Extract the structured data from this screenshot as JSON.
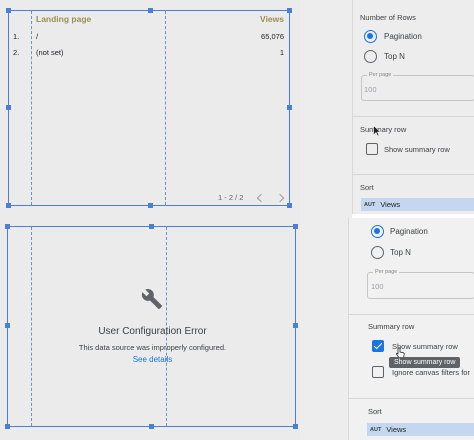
{
  "table": {
    "columns": [
      "Landing page",
      "Views"
    ],
    "rows": [
      {
        "index": "1.",
        "page": "/",
        "views": "65,076"
      },
      {
        "index": "2.",
        "page": "(not set)",
        "views": "1"
      }
    ],
    "pagination": "1 - 2 / 2"
  },
  "error": {
    "title": "User Configuration Error",
    "message": "This data source was improperly configured.",
    "link": "See details"
  },
  "props_top": {
    "number_of_rows_label": "Number of Rows",
    "pagination_label": "Pagination",
    "topn_label": "Top N",
    "per_page_label": "Per page",
    "per_page_value": "100",
    "summary_row_label": "Summary row",
    "show_summary_label": "Show summary row",
    "sort_label": "Sort",
    "sort_type": "AUT",
    "sort_field": "Views"
  },
  "props_bottom": {
    "pagination_label": "Pagination",
    "topn_label": "Top N",
    "per_page_label": "Per page",
    "per_page_value": "100",
    "summary_row_label": "Summary row",
    "show_summary_label": "Show summary row",
    "tooltip_text": "Show summary row",
    "ignore_filters_label": "Ignore canvas filters for",
    "sort_label": "Sort",
    "sort_type": "AUT",
    "sort_field": "Views"
  },
  "state": {
    "top_pagination_selected": true,
    "top_show_summary_checked": false,
    "bottom_pagination_selected": true,
    "bottom_show_summary_checked": true,
    "bottom_ignore_filters_checked": false
  },
  "colors": {
    "accent": "#1a73e8",
    "selection": "#4a7fd6",
    "header_text": "#9e8d55",
    "sort_chip": "#c5d6f0"
  },
  "icons": {
    "error": "wrench-icon",
    "cursor": "mouse-pointer-icon"
  }
}
